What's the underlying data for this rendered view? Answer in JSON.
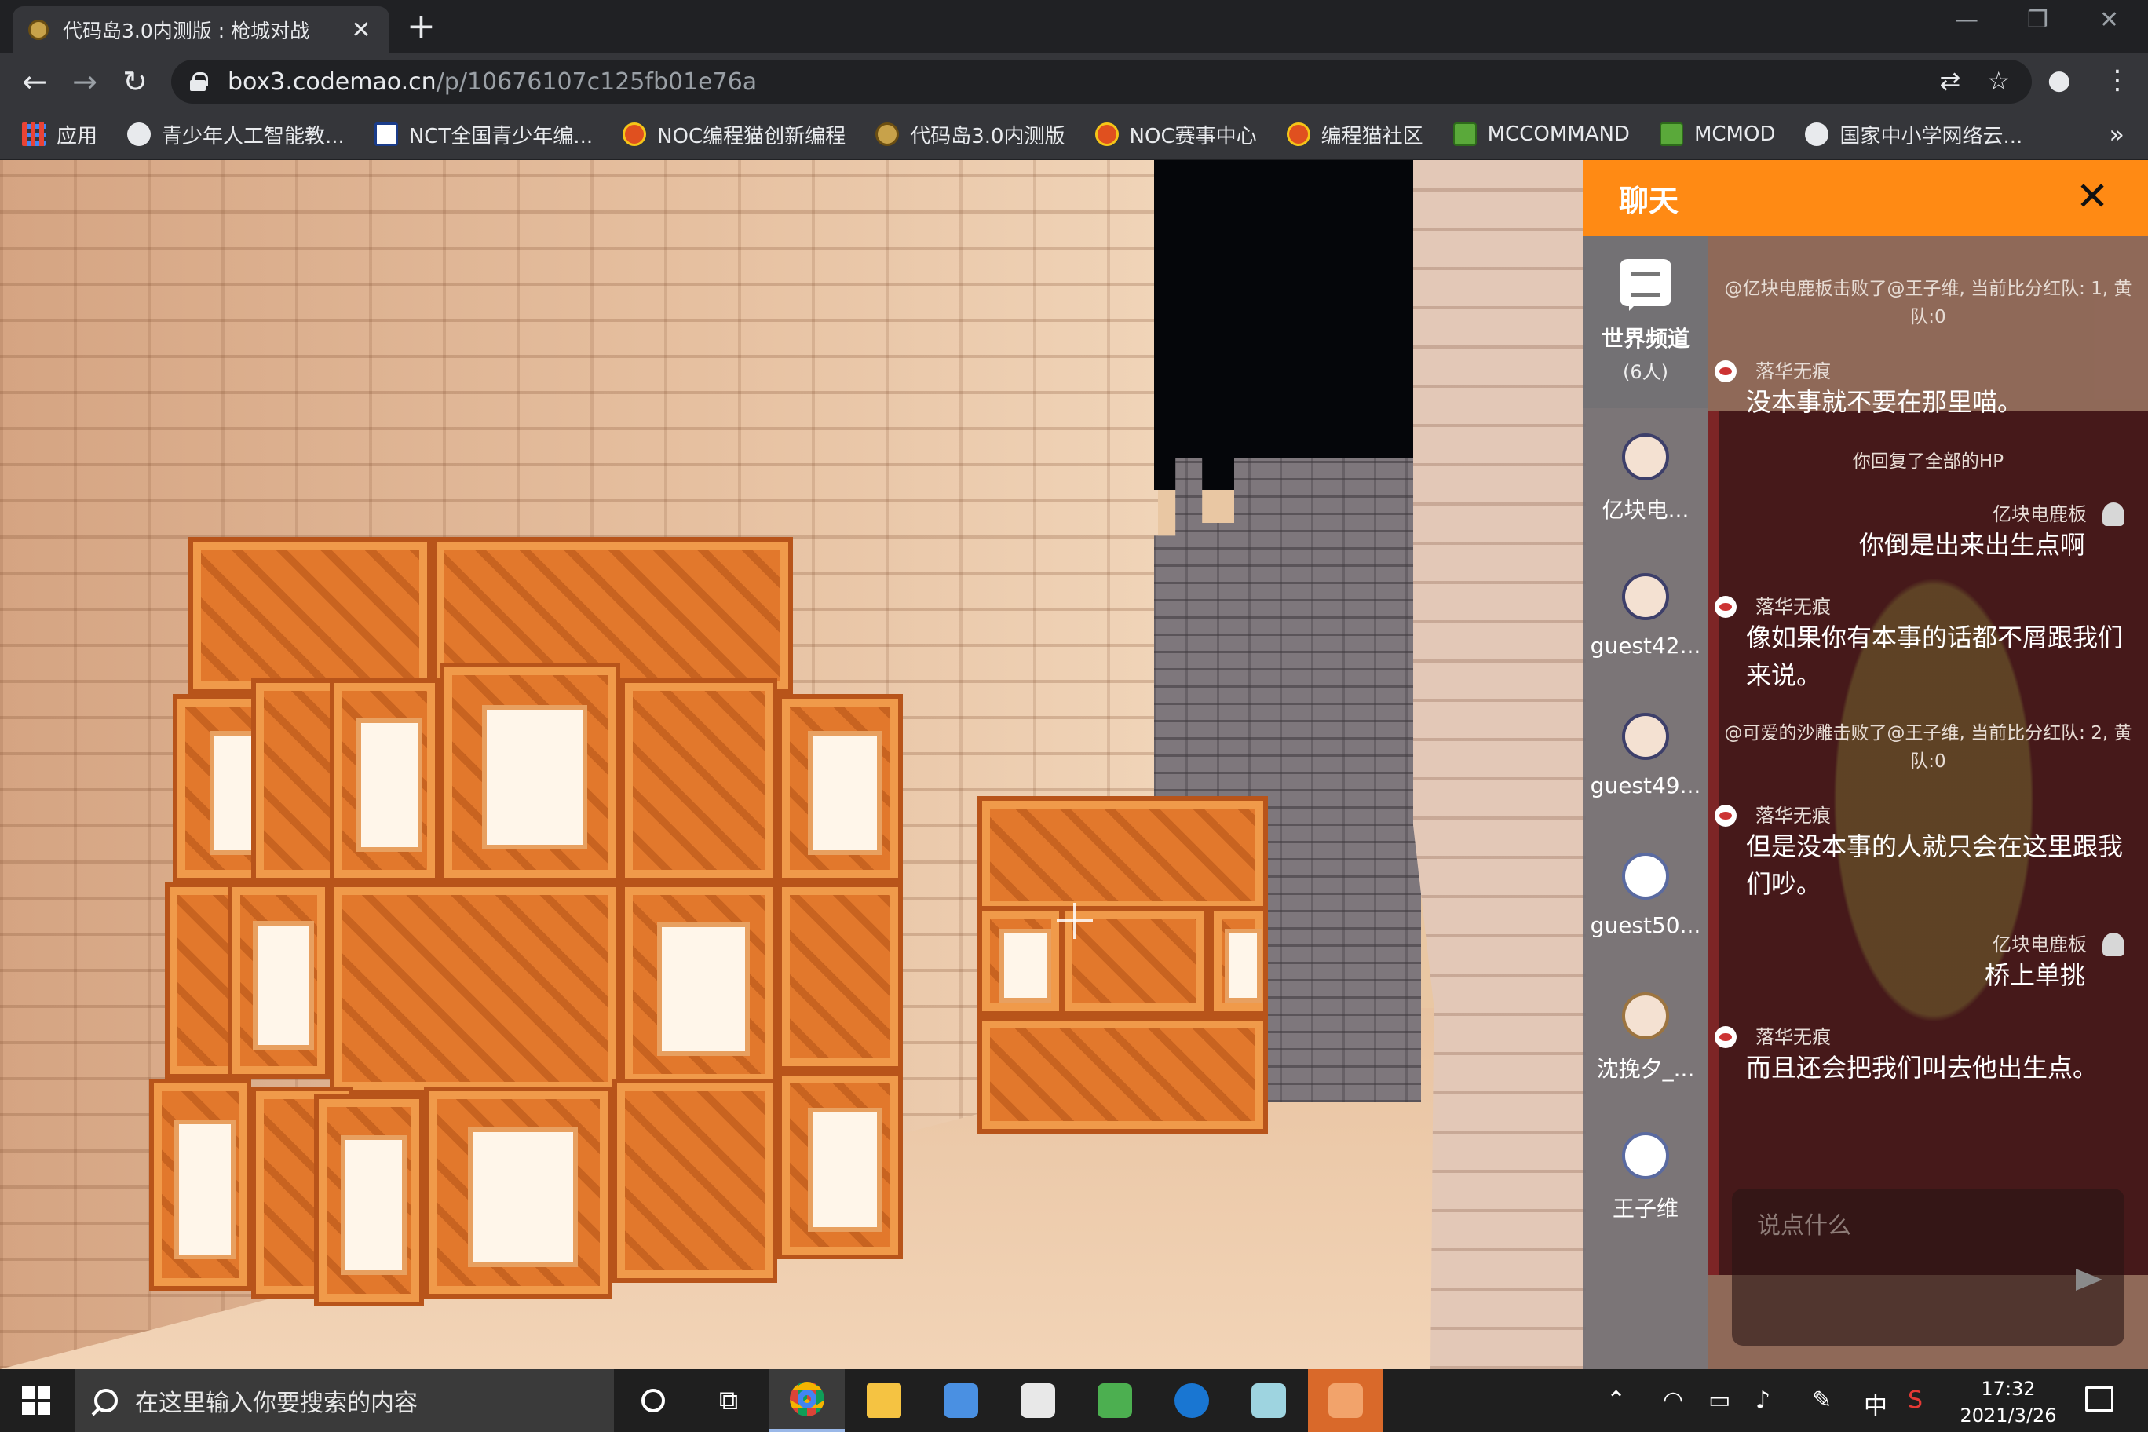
{
  "browser": {
    "tab_title": "代码岛3.0内测版 : 枪城对战",
    "tab_close": "✕",
    "new_tab": "+",
    "url_host": "box3.codemao.cn",
    "url_path": "/p/10676107c125fb01e76a",
    "bookmarks": [
      {
        "label": "应用",
        "icon": "apps-grid-icon"
      },
      {
        "label": "青少年人工智能教...",
        "icon": "globe-icon"
      },
      {
        "label": "NCT全国青少年编...",
        "icon": "nct-logo-icon"
      },
      {
        "label": "NOC编程猫创新编程",
        "icon": "codemao-cat-icon"
      },
      {
        "label": "代码岛3.0内测版",
        "icon": "box3-logo-icon"
      },
      {
        "label": "NOC赛事中心",
        "icon": "codemao-cat-icon"
      },
      {
        "label": "编程猫社区",
        "icon": "codemao-cat-icon"
      },
      {
        "label": "MCCOMMAND",
        "icon": "mc-logo-icon"
      },
      {
        "label": "MCMOD",
        "icon": "mc-logo-icon"
      },
      {
        "label": "国家中小学网络云...",
        "icon": "globe-icon"
      }
    ],
    "more_bookmarks": "»"
  },
  "chat": {
    "title": "聊天",
    "close": "✕",
    "channel": {
      "name": "世界频道",
      "count": "(6人)"
    },
    "members": [
      {
        "name": "亿块电...",
        "avatar": "avatar-officer"
      },
      {
        "name": "guest42...",
        "avatar": "avatar-officer"
      },
      {
        "name": "guest49...",
        "avatar": "avatar-officer"
      },
      {
        "name": "guest50...",
        "avatar": "avatar-plain"
      },
      {
        "name": "沈挽夕_...",
        "avatar": "avatar-girl"
      },
      {
        "name": "王子维",
        "avatar": "avatar-plain"
      }
    ],
    "messages": [
      {
        "type": "system",
        "text": "@亿块电鹿板击败了@王子维, 当前比分红队: 1, 黄队:0"
      },
      {
        "type": "left",
        "who": "落华无痕",
        "text": "没本事就不要在那里喵。"
      },
      {
        "type": "system",
        "text": "你回复了全部的HP"
      },
      {
        "type": "right",
        "who": "亿块电鹿板",
        "text": "你倒是出来出生点啊"
      },
      {
        "type": "left",
        "who": "落华无痕",
        "text": "像如果你有本事的话都不屑跟我们来说。"
      },
      {
        "type": "system",
        "text": "@可爱的沙雕击败了@王子维, 当前比分红队: 2, 黄队:0"
      },
      {
        "type": "left",
        "who": "落华无痕",
        "text": "但是没本事的人就只会在这里跟我们吵。"
      },
      {
        "type": "right",
        "who": "亿块电鹿板",
        "text": "桥上单挑"
      },
      {
        "type": "left",
        "who": "落华无痕",
        "text": "而且还会把我们叫去他出生点。"
      }
    ],
    "input_placeholder": "说点什么"
  },
  "taskbar": {
    "search_placeholder": "在这里输入你要搜索的内容",
    "ime": "中",
    "time": "17:32",
    "date": "2021/3/26"
  }
}
